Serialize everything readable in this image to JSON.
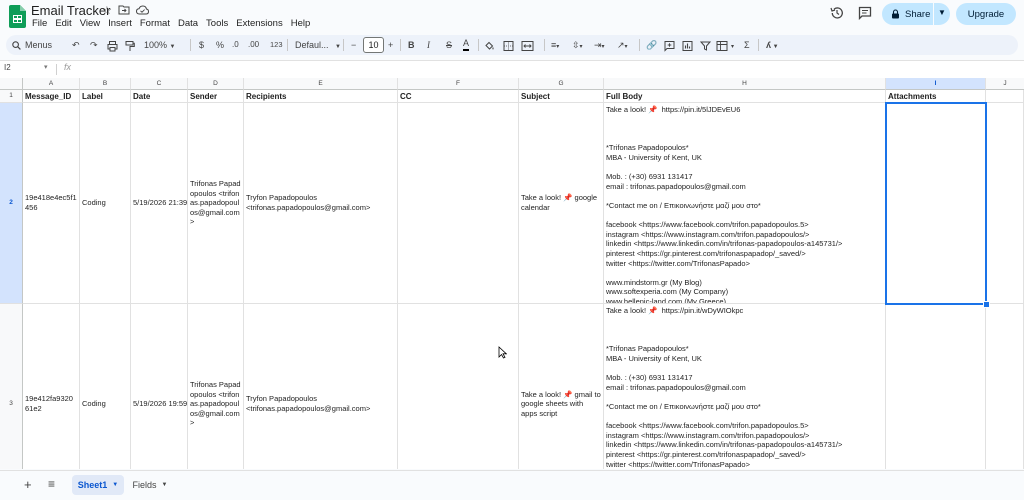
{
  "app": {
    "title": "Email Tracker",
    "menu": [
      "File",
      "Edit",
      "View",
      "Insert",
      "Format",
      "Data",
      "Tools",
      "Extensions",
      "Help"
    ],
    "share_label": "Share",
    "upgrade_label": "Upgrade",
    "accent": "#0b57d0",
    "sheets_green": "#0f9d58"
  },
  "toolbar": {
    "menus_label": "Menus",
    "zoom": "100%",
    "currency": "$",
    "percent": "%",
    "dec_decrease": ".0",
    "dec_increase": ".00",
    "format_more": "123",
    "font": "Defaul...",
    "minus": "−",
    "font_size": "10",
    "plus": "+",
    "bold": "B",
    "italic": "I",
    "strike": "S",
    "text_color": "A",
    "sigma": "Σ"
  },
  "formula_bar": {
    "name_box": "I2",
    "fx": "fx",
    "content": ""
  },
  "grid": {
    "columns": [
      "A",
      "B",
      "C",
      "D",
      "E",
      "F",
      "G",
      "H",
      "I",
      "J"
    ],
    "selected_column": "I",
    "row_numbers": [
      "1",
      "2",
      "3"
    ],
    "selected_row": "2",
    "headers": {
      "a": "Message_ID",
      "b": "Label",
      "c": "Date",
      "d": "Sender",
      "e": "Recipients",
      "f": "CC",
      "g": "Subject",
      "h": "Full Body",
      "i": "Attachments",
      "j": ""
    },
    "rows": [
      {
        "id": "19e418e4ec5f1456",
        "label": "Coding",
        "date": "5/19/2026 21:39",
        "sender": "Trifonas Papadopoulos <trifonas.papadopoulos@gmail.com>",
        "recipients": "Tryfon Papadopoulos <trifonas.papadopoulos@gmail.com>",
        "cc": "",
        "subject": "Take a look! 📌 google calendar",
        "body": "Take a look! 📌  https://pin.it/5lJDEvEU6\n\n\n\n*Trifonas Papadopoulos*\nMBA - University of Kent, UK\n\nMob. : (+30) 6931 131417\nemail : trifonas.papadopoulos@gmail.com\n\n*Contact me on / Επικοινωνήστε μαζί μου στο*\n\nfacebook <https://www.facebook.com/trifon.papadopoulos.5>\ninstagram <https://www.instagram.com/trifon.papadopoulos/>\nlinkedin <https://www.linkedin.com/in/trifonas-papadopoulos-a145731/>\npinterest <https://gr.pinterest.com/trifonaspapadop/_saved/>\ntwitter <https://twitter.com/TrifonasPapado>\n\nwww.mindstorm.gr (My Blog)\nwww.softexperia.com (My Company)\nwww.hellenic-land.com (My Greece)",
        "attachments": ""
      },
      {
        "id": "19e412fa932061e2",
        "label": "Coding",
        "date": "5/19/2026 19:59",
        "sender": "Trifonas Papadopoulos <trifonas.papadopoulos@gmail.com>",
        "recipients": "Tryfon Papadopoulos <trifonas.papadopoulos@gmail.com>",
        "cc": "",
        "subject": "Take a look! 📌 gmail to google sheets with apps script",
        "body": "Take a look! 📌  https://pin.it/wDyWIOkpc\n\n\n\n*Trifonas Papadopoulos*\nMBA - University of Kent, UK\n\nMob. : (+30) 6931 131417\nemail : trifonas.papadopoulos@gmail.com\n\n*Contact me on / Επικοινωνήστε μαζί μου στο*\n\nfacebook <https://www.facebook.com/trifon.papadopoulos.5>\ninstagram <https://www.instagram.com/trifon.papadopoulos/>\nlinkedin <https://www.linkedin.com/in/trifonas-papadopoulos-a145731/>\npinterest <https://gr.pinterest.com/trifonaspapadop/_saved/>\ntwitter <https://twitter.com/TrifonasPapado>\n\nwww.mindstorm.gr (My Blog)",
        "attachments": ""
      }
    ]
  },
  "sheets": {
    "tabs": [
      "Sheet1",
      "Fields"
    ],
    "active": "Sheet1"
  }
}
